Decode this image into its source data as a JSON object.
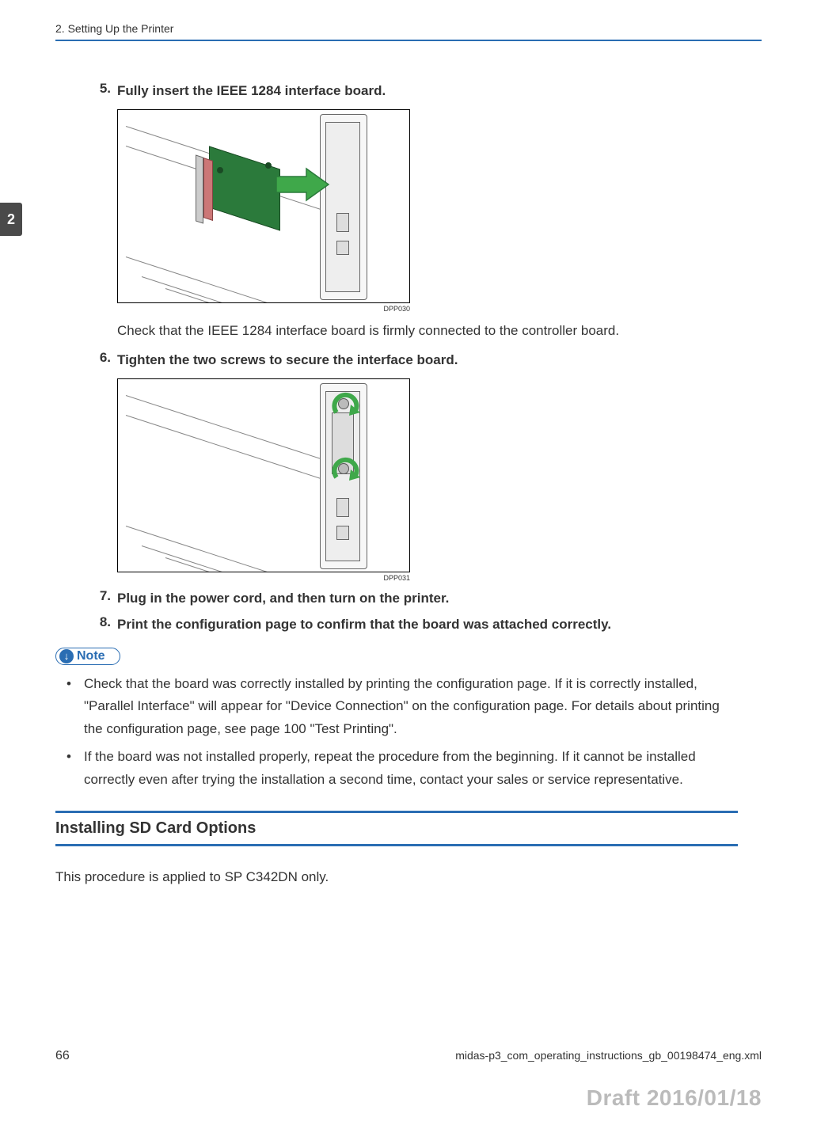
{
  "header": {
    "chapter_title": "2. Setting Up the Printer"
  },
  "tab": {
    "chapter_number": "2"
  },
  "steps": {
    "s5": {
      "num": "5.",
      "text": "Fully insert the IEEE 1284 interface board."
    },
    "s5_fig_caption": "DPP030",
    "s5_note": "Check that the IEEE 1284 interface board is firmly connected to the controller board.",
    "s6": {
      "num": "6.",
      "text": "Tighten the two screws to secure the interface board."
    },
    "s6_fig_caption": "DPP031",
    "s7": {
      "num": "7.",
      "text": "Plug in the power cord, and then turn on the printer."
    },
    "s8": {
      "num": "8.",
      "text": "Print the configuration page to confirm that the board was attached correctly."
    }
  },
  "note": {
    "label": "Note",
    "bullets": [
      "Check that the board was correctly installed by printing the configuration page. If it is correctly installed, \"Parallel Interface\" will appear for \"Device Connection\" on the configuration page. For details about printing the configuration page, see page 100 \"Test Printing\".",
      "If the board was not installed properly, repeat the procedure from the beginning. If it cannot be installed correctly even after trying the installation a second time, contact your sales or service representative."
    ]
  },
  "section": {
    "heading": "Installing SD Card Options",
    "body": "This procedure is applied to SP C342DN only."
  },
  "footer": {
    "page_number": "66",
    "source_file": "midas-p3_com_operating_instructions_gb_00198474_eng.xml"
  },
  "draft_stamp": "Draft 2016/01/18"
}
